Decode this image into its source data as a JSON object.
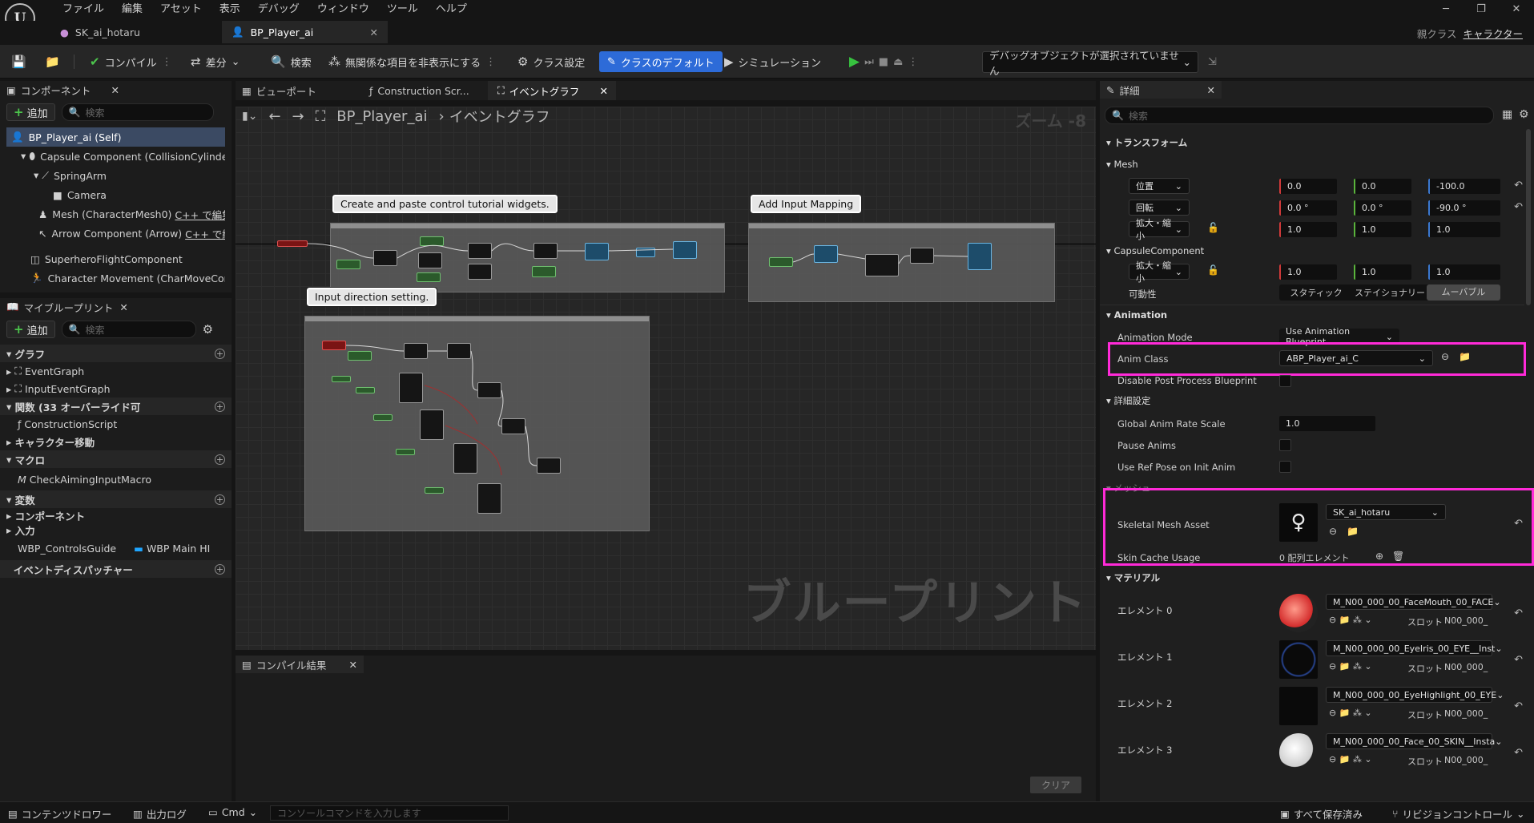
{
  "menu": [
    "ファイル",
    "編集",
    "アセット",
    "表示",
    "デバッグ",
    "ウィンドウ",
    "ツール",
    "ヘルプ"
  ],
  "tabs": [
    {
      "label": "SK_ai_hotaru"
    },
    {
      "label": "BP_Player_ai"
    }
  ],
  "parent_class": {
    "label": "親クラス",
    "value": "キャラクター"
  },
  "toolbar": {
    "compile": "コンパイル",
    "diff": "差分",
    "search": "検索",
    "hide_unrelated": "無関係な項目を非表示にする",
    "class_settings": "クラス設定",
    "class_defaults": "クラスのデフォルト",
    "simulation": "シミュレーション",
    "debug_object": "デバッグオブジェクトが選択されていません"
  },
  "components_panel": {
    "title": "コンポーネント",
    "add": "追加",
    "search_placeholder": "検索",
    "items": [
      "BP_Player_ai (Self)",
      "Capsule Component (CollisionCylinde",
      "SpringArm",
      "Camera",
      "Mesh (CharacterMesh0)",
      "Arrow Component (Arrow)",
      "SuperheroFlightComponent",
      "Character Movement (CharMoveCon"
    ],
    "cpp_edit": "C++ で編集"
  },
  "my_blueprint": {
    "title": "マイブループリント",
    "add": "追加",
    "search_placeholder": "検索",
    "graphs_header": "グラフ",
    "graphs": [
      "EventGraph",
      "InputEventGraph"
    ],
    "functions_header": "関数 (33 オーバーライド可",
    "functions": [
      "ConstructionScript"
    ],
    "char_move": "キャラクター移動",
    "macros_header": "マクロ",
    "macros": [
      "CheckAimingInputMacro"
    ],
    "variables_header": "変数",
    "var_groups": [
      "コンポーネント",
      "入力"
    ],
    "var_item": "WBP_ControlsGuide",
    "var_type": "WBP Main HI",
    "dispatchers_header": "イベントディスパッチャー"
  },
  "editor_tabs": [
    "ビューポート",
    "Construction Scr...",
    "イベントグラフ"
  ],
  "graph": {
    "breadcrumb_bp": "BP_Player_ai",
    "breadcrumb_graph": "イベントグラフ",
    "zoom": "ズーム -8",
    "comments": [
      "Create and paste control tutorial widgets.",
      "Add Input Mapping",
      "Input direction setting."
    ],
    "watermark": "ブループリント"
  },
  "compile_results": {
    "title": "コンパイル結果",
    "clear": "クリア"
  },
  "details": {
    "title": "詳細",
    "search_placeholder": "検索",
    "transform": "トランスフォーム",
    "mesh": "Mesh",
    "location": "位置",
    "location_vals": [
      "0.0",
      "0.0",
      "-100.0"
    ],
    "rotation": "回転",
    "rotation_vals": [
      "0.0 °",
      "0.0 °",
      "-90.0 °"
    ],
    "scale": "拡大・縮小",
    "scale_vals": [
      "1.0",
      "1.0",
      "1.0"
    ],
    "capsule": "CapsuleComponent",
    "capsule_scale_vals": [
      "1.0",
      "1.0",
      "1.0"
    ],
    "mobility": "可動性",
    "mobility_opts": [
      "スタティック",
      "ステイショナリー",
      "ムーバブル"
    ],
    "animation": "Animation",
    "anim_mode": "Animation Mode",
    "anim_mode_val": "Use Animation Blueprint",
    "anim_class": "Anim Class",
    "anim_class_val": "ABP_Player_ai_C",
    "disable_pp": "Disable Post Process Blueprint",
    "advanced": "詳細設定",
    "global_rate": "Global Anim Rate Scale",
    "global_rate_val": "1.0",
    "pause_anims": "Pause Anims",
    "ref_pose": "Use Ref Pose on Init Anim",
    "mesh_sec": "メッシュ",
    "skel_mesh": "Skeletal Mesh Asset",
    "skel_mesh_val": "SK_ai_hotaru",
    "skin_cache": "Skin Cache Usage",
    "skin_cache_val": "0 配列エレメント",
    "materials": "マテリアル",
    "elements": [
      {
        "label": "エレメント 0",
        "mat": "M_N00_000_00_FaceMouth_00_FACE"
      },
      {
        "label": "エレメント 1",
        "mat": "M_N00_000_00_EyeIris_00_EYE__Inst"
      },
      {
        "label": "エレメント 2",
        "mat": "M_N00_000_00_EyeHighlight_00_EYE"
      },
      {
        "label": "エレメント 3",
        "mat": "M_N00_000_00_Face_00_SKIN__Insta"
      }
    ],
    "slot": "スロット",
    "slot_val": "N00_000_"
  },
  "status": {
    "content_drawer": "コンテンツドロワー",
    "output_log": "出力ログ",
    "cmd": "Cmd",
    "console_placeholder": "コンソールコマンドを入力します",
    "save_all": "すべて保存済み",
    "revision": "リビジョンコントロール"
  }
}
